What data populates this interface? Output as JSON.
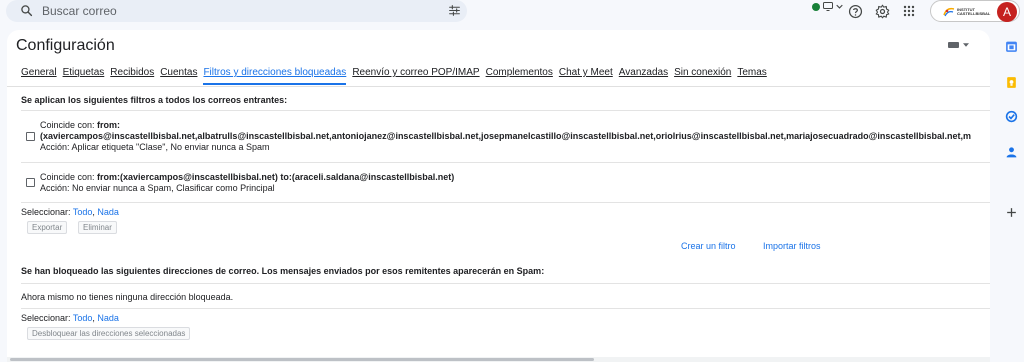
{
  "search": {
    "placeholder": "Buscar correo"
  },
  "school": {
    "logo_text_line1": "INSTITUT",
    "logo_text_line2": "CASTELLBISBAL"
  },
  "account": {
    "avatar_letter": "A"
  },
  "page_title": "Configuración",
  "tabs": [
    {
      "label": "General"
    },
    {
      "label": "Etiquetas"
    },
    {
      "label": "Recibidos"
    },
    {
      "label": "Cuentas"
    },
    {
      "label": "Filtros y direcciones bloqueadas",
      "active": true
    },
    {
      "label": "Reenvío y correo POP/IMAP"
    },
    {
      "label": "Complementos"
    },
    {
      "label": "Chat y Meet"
    },
    {
      "label": "Avanzadas"
    },
    {
      "label": "Sin conexión"
    },
    {
      "label": "Temas"
    }
  ],
  "filters_section": {
    "title": "Se aplican los siguientes filtros a todos los correos entrantes:",
    "filters": [
      {
        "match_prefix": "Coincide con: ",
        "match_bold": "from:",
        "match_line2": "(xaviercampos@inscastellbisbal.net,albatrulls@inscastellbisbal.net,antoniojanez@inscastellbisbal.net,josepmanelcastillo@inscastellbisbal.net,oriolrius@inscastellbisbal.net,mariajosecuadrado@inscastellbisbal.net,m",
        "action": "Acción: Aplicar etiqueta \"Clase\", No enviar nunca a Spam"
      },
      {
        "match_prefix": "Coincide con: ",
        "match_bold": "from:(xaviercampos@inscastellbisbal.net) to:(araceli.saldana@inscastellbisbal.net)",
        "action": "Acción: No enviar nunca a Spam, Clasificar como Principal"
      }
    ],
    "select_label": "Seleccionar:",
    "select_all": "Todo",
    "select_none": "Nada",
    "export_button": "Exportar",
    "delete_button": "Eliminar",
    "create_filter_link": "Crear un filtro",
    "import_filters_link": "Importar filtros"
  },
  "blocked_section": {
    "title": "Se han bloqueado las siguientes direcciones de correo. Los mensajes enviados por esos remitentes aparecerán en Spam:",
    "empty_message": "Ahora mismo no tienes ninguna dirección bloqueada.",
    "select_label": "Seleccionar:",
    "select_all": "Todo",
    "select_none": "Nada",
    "unblock_button": "Desbloquear las direcciones seleccionadas"
  },
  "colors": {
    "accent": "#1a73e8",
    "status_green": "#188038",
    "avatar_bg": "#c5221f",
    "page_bg": "#f6f8fc"
  },
  "icons": {
    "search": "search-icon",
    "search_options": "tune-icon",
    "status": "status-dot-icon",
    "help": "help-icon",
    "settings": "gear-icon",
    "apps": "apps-grid-icon",
    "keyboard": "keyboard-icon",
    "rail": [
      "calendar-icon",
      "keep-icon",
      "tasks-icon",
      "contacts-icon",
      "add-icon"
    ]
  }
}
